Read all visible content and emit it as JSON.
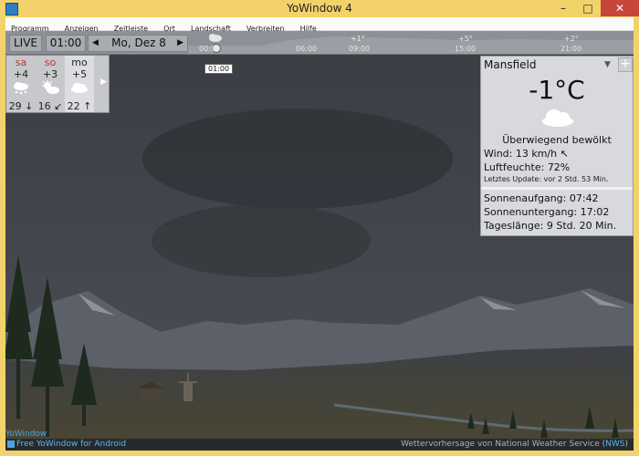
{
  "window": {
    "title": "YoWindow 4",
    "minimize": "–",
    "maximize": "□",
    "close": "✕"
  },
  "menu": [
    "Programm",
    "Anzeigen",
    "Zeitleiste",
    "Ort",
    "Landschaft",
    "Verbreiten",
    "Hilfe"
  ],
  "timebar": {
    "live": "LIVE",
    "time": "01:00",
    "date": "Mo, Dez 8",
    "prev": "◀",
    "next": "▶",
    "hours": [
      "00:00",
      "06:00",
      "09:00",
      "15:00",
      "21:00"
    ],
    "temps": [
      "+1°",
      "+5°",
      "+2°"
    ],
    "tooltip": "01:00"
  },
  "forecast": [
    {
      "name": "sa",
      "temp": "+4",
      "icon": "snow-cloud-icon",
      "foot": "29 ↓"
    },
    {
      "name": "so",
      "temp": "+3",
      "icon": "sun-cloud-icon",
      "foot": "16 ↙"
    },
    {
      "name": "mo",
      "temp": "+5",
      "icon": "cloud-icon",
      "foot": "22 ↑"
    }
  ],
  "forecast_more": "▶",
  "panel": {
    "city": "Mansfield",
    "dropdown": "▼",
    "add": "+",
    "temperature": "-1°C",
    "condition": "Überwiegend bewölkt",
    "wind": "Wind:  13 km/h  ↖",
    "humidity": "Luftfeuchte:  72%",
    "updated": "Letztes Update:  vor 2 Std. 53 Min.",
    "sunrise": "Sonnenaufgang:  07:42",
    "sunset": "Sonnenuntergang:  17:02",
    "daylength": "Tageslänge:  9 Std. 20 Min."
  },
  "footer": {
    "brand": "YoWindow",
    "android": "Free YoWindow for Android",
    "credit": "Wettervorhersage von National Weather Service (",
    "credit_link": "NWS",
    "credit_end": ")"
  }
}
